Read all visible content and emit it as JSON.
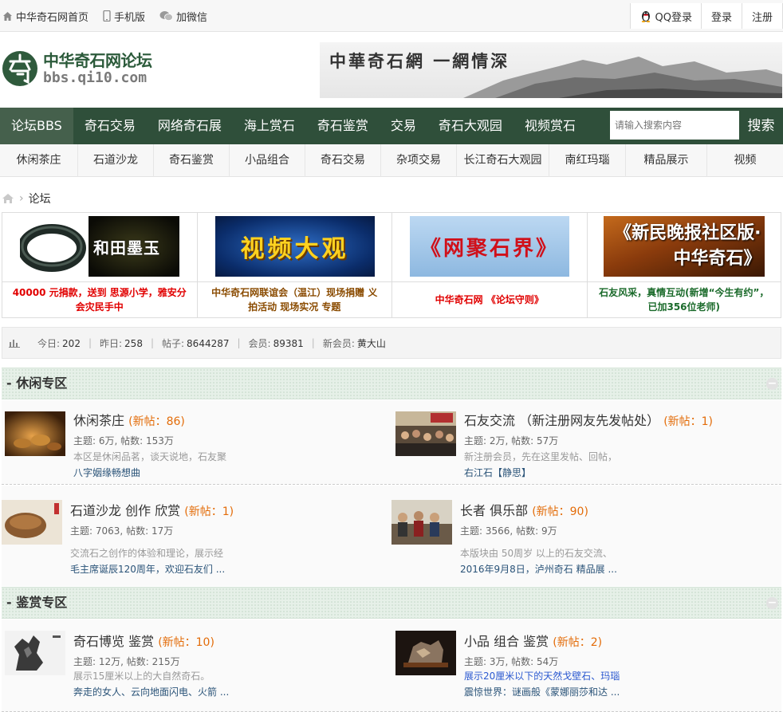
{
  "topbar": {
    "home": "中华奇石网首页",
    "mobile": "手机版",
    "wechat": "加微信",
    "qq_login": "QQ登录",
    "login": "登录",
    "register": "注册"
  },
  "header": {
    "logo_title": "中华奇石网论坛",
    "logo_url": "bbs.qi10.com",
    "banner_slogan": "中華奇石網  一網情深"
  },
  "nav": {
    "items": [
      "论坛BBS",
      "奇石交易",
      "网络奇石展",
      "海上赏石",
      "奇石鉴赏",
      "交易",
      "奇石大观园",
      "视频赏石"
    ],
    "search_placeholder": "请输入搜索内容",
    "search_button": "搜索"
  },
  "subnav": [
    "休闲茶庄",
    "石道沙龙",
    "奇石鉴赏",
    "小品组合",
    "奇石交易",
    "杂项交易",
    "长江奇石大观园",
    "南红玛瑙",
    "精品展示",
    "视频"
  ],
  "breadcrumb": {
    "current": "论坛"
  },
  "promo": [
    {
      "image_text": "和田墨玉",
      "caption": "40000 元捐款，送到 思源小学，雅安分会灾民手中",
      "color": "#e10000"
    },
    {
      "image_text": "视频大观",
      "caption": "中华奇石网联谊会（温江）现场捐赠 义拍活动 现场实况 专题",
      "color": "#8a4b00"
    },
    {
      "image_text": "《网聚石界》",
      "caption": "中华奇石网 《论坛守则》",
      "color": "#e10000"
    },
    {
      "image_text": "《新民晚报社区版·中华奇石》",
      "caption": "石友风采，真情互动(新增“今生有约”，已加356位老师)",
      "color": "#1a6a2a"
    }
  ],
  "stats": {
    "today_label": "今日:",
    "today": "202",
    "yesterday_label": "昨日:",
    "yesterday": "258",
    "posts_label": "帖子:",
    "posts": "8644287",
    "members_label": "会员:",
    "members": "89381",
    "newest_label": "新会员:",
    "newest": "黄大山"
  },
  "sections": [
    {
      "title": "- 休闲专区",
      "collapse": "−",
      "forums": [
        {
          "name": "休闲茶庄",
          "new": "(新帖：86)",
          "topics_label": "主题:",
          "topics": "6万",
          "posts_label": "帖数:",
          "posts": "153万",
          "desc": "本区是休闲品茗，谈天说地，石友聚",
          "last": "八字姻缘畅想曲"
        },
        {
          "name": "石友交流 （新注册网友先发帖处）",
          "new": "(新帖：1)",
          "topics_label": "主题:",
          "topics": "2万",
          "posts_label": "帖数:",
          "posts": "57万",
          "desc": "新注册会员，先在这里发帖、回帖，",
          "last": "右江石【静思】"
        },
        {
          "name": "石道沙龙 创作 欣赏",
          "new": "(新帖：1)",
          "topics_label": "主题:",
          "topics": "7063",
          "posts_label": "帖数:",
          "posts": "17万",
          "desc": "交流石之创作的体验和理论，展示经",
          "last": "毛主席诞辰120周年，欢迎石友们 ..."
        },
        {
          "name": "长者 俱乐部",
          "new": "(新帖：90)",
          "topics_label": "主题:",
          "topics": "3566",
          "posts_label": "帖数:",
          "posts": "9万",
          "desc": "本版块由 50周岁 以上的石友交流、",
          "last": "2016年9月8日，泸州奇石 精品展 ..."
        }
      ]
    },
    {
      "title": "- 鉴赏专区",
      "collapse": "−",
      "forums": [
        {
          "name": "奇石博览 鉴赏",
          "new": "(新帖：10)",
          "topics_label": "主题:",
          "topics": "12万",
          "posts_label": "帖数:",
          "posts": "215万",
          "desc": "展示15厘米以上的大自然奇石。",
          "last": "奔走的女人、云向地面闪电、火箭 ..."
        },
        {
          "name": "小品 组合 鉴赏",
          "new": "(新帖：2)",
          "topics_label": "主题:",
          "topics": "3万",
          "posts_label": "帖数:",
          "posts": "54万",
          "desc": "展示20厘米以下的天然戈壁石、玛瑙",
          "last": "震惊世界：谜画般《蒙娜丽莎和达 ..."
        }
      ]
    }
  ],
  "colors": {
    "nav_bg": "#2f4f3a",
    "new_posts": "#e36c09",
    "link": "#2a5378"
  }
}
